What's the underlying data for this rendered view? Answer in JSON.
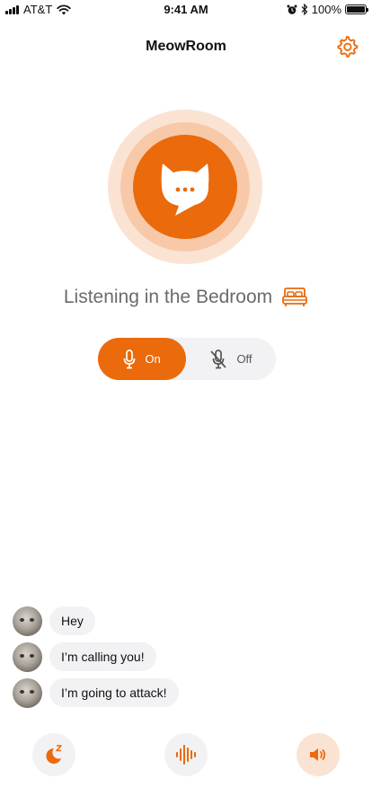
{
  "status_bar": {
    "carrier": "AT&T",
    "time": "9:41 AM",
    "battery": "100%"
  },
  "header": {
    "title": "MeowRoom",
    "settings_icon": "gear-icon"
  },
  "listening": {
    "text": "Listening in the Bedroom",
    "room_icon": "bed-icon"
  },
  "toggle": {
    "on_label": "On",
    "off_label": "Off",
    "selected": "On"
  },
  "messages": [
    {
      "text": "Hey"
    },
    {
      "text": "I’m calling you!"
    },
    {
      "text": "I’m going to attack!"
    }
  ],
  "bottom_bar": {
    "buttons": [
      "sleep-moon-icon",
      "sound-wave-icon",
      "speaker-icon"
    ]
  },
  "colors": {
    "accent": "#ea6a0c",
    "accent_light": "#fbe3d3",
    "accent_mid": "#f8c9a8",
    "bubble_bg": "#f2f2f4",
    "muted_text": "#6b6b6b"
  }
}
